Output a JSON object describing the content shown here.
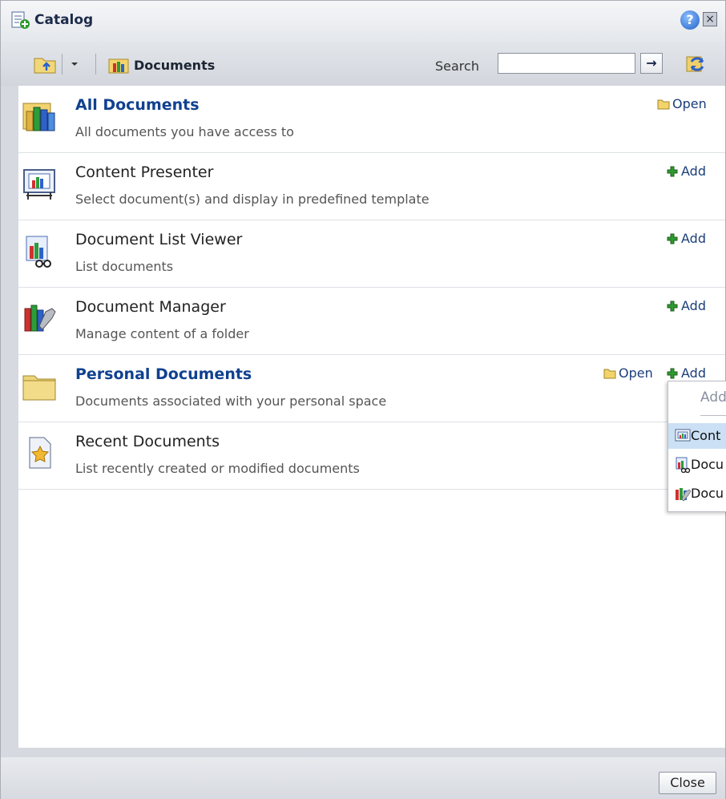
{
  "window": {
    "title": "Catalog",
    "help_glyph": "?",
    "close_glyph": "×"
  },
  "toolbar": {
    "breadcrumb": "Documents",
    "search_label": "Search",
    "search_value": "",
    "search_placeholder": "",
    "go_glyph": "→"
  },
  "items": [
    {
      "name": "All Documents",
      "desc": "All documents you have access to",
      "open": "Open",
      "add": "",
      "icon": "books-icon"
    },
    {
      "name": "Content Presenter",
      "desc": "Select document(s) and display in predefined template",
      "open": "",
      "add": "Add",
      "icon": "presentation-board-icon"
    },
    {
      "name": "Document List Viewer",
      "desc": "List documents",
      "open": "",
      "add": "Add",
      "icon": "chart-glasses-icon"
    },
    {
      "name": "Document Manager",
      "desc": "Manage content of a folder",
      "open": "",
      "add": "Add",
      "icon": "books-wrench-icon"
    },
    {
      "name": "Personal Documents",
      "desc": "Documents associated with your personal space",
      "open": "Open",
      "add": "Add",
      "icon": "folder-icon"
    },
    {
      "name": "Recent Documents",
      "desc": "List recently created or modified documents",
      "open": "",
      "add": "",
      "icon": "star-document-icon"
    }
  ],
  "popup": {
    "header": "Add",
    "items": [
      {
        "label": "Cont",
        "icon": "presentation-board-icon"
      },
      {
        "label": "Docu",
        "icon": "chart-glasses-icon"
      },
      {
        "label": "Docu",
        "icon": "books-wrench-icon"
      }
    ]
  },
  "footer": {
    "close_label": "Close"
  },
  "colors": {
    "accent_link": "#10418f",
    "add_green": "#2f9a2f",
    "highlight": "#cbe0f5"
  }
}
